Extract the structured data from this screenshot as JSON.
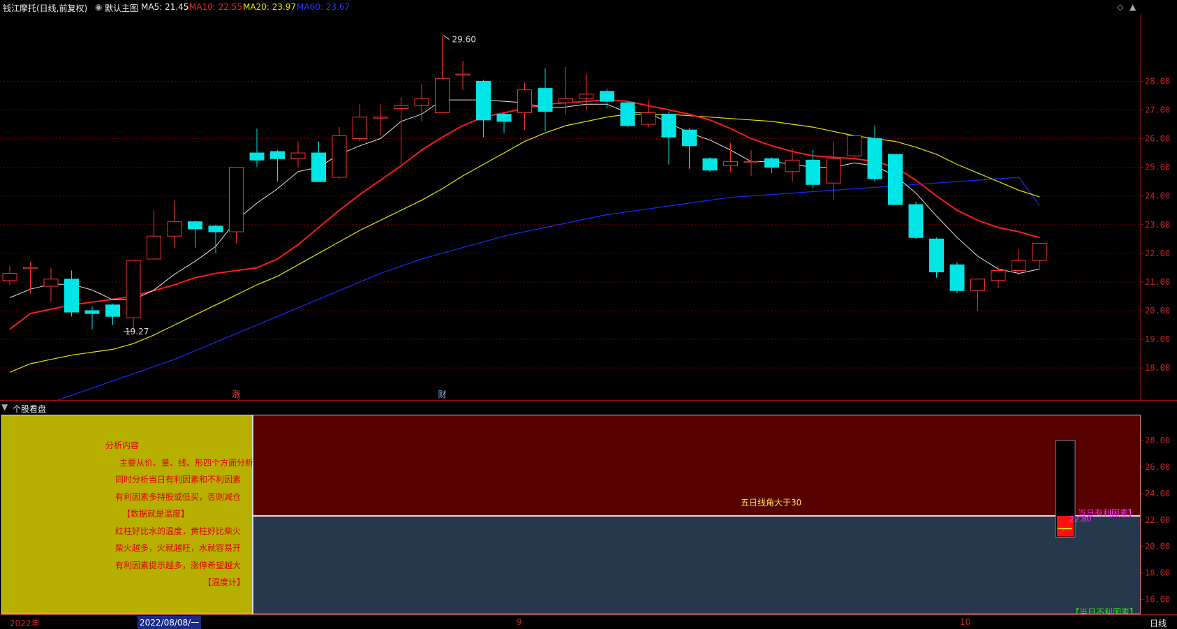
{
  "toolbar": {
    "title": "钱江摩托(日线,前复权)",
    "template": "默认主图",
    "ma5": "MA5: 21.45",
    "ma10": "MA10: 22.55",
    "ma20": "MA20: 23.97",
    "ma60": "MA60: 23.67"
  },
  "colors": {
    "up": "#ff3030",
    "down": "#00e5e5",
    "ma5": "#e8e8e8",
    "ma10": "#ff1a1a",
    "ma20": "#e6e600",
    "ma60": "#1a2aff",
    "grid": "#700000"
  },
  "chart_data": {
    "type": "candlestick",
    "y_ticks": [
      "28.00",
      "27.00",
      "26.00",
      "25.00",
      "24.00",
      "23.00",
      "22.00",
      "21.00",
      "20.00",
      "19.00",
      "18.00"
    ],
    "ylim": [
      17.2,
      30.2
    ],
    "high_label": "29.60",
    "low_label": "19.27",
    "event_markers": [
      {
        "label": "涨",
        "index": 11
      },
      {
        "label": "财",
        "index": 21
      }
    ],
    "candles": [
      {
        "o": 21.05,
        "c": 21.3,
        "h": 21.55,
        "l": 20.9
      },
      {
        "o": 21.5,
        "c": 21.5,
        "h": 21.7,
        "l": 20.6
      },
      {
        "o": 20.85,
        "c": 21.1,
        "h": 21.5,
        "l": 20.3
      },
      {
        "o": 21.1,
        "c": 19.95,
        "h": 21.4,
        "l": 19.8
      },
      {
        "o": 20.0,
        "c": 19.9,
        "h": 20.15,
        "l": 19.35
      },
      {
        "o": 20.2,
        "c": 19.8,
        "h": 20.25,
        "l": 19.5
      },
      {
        "o": 19.75,
        "c": 21.75,
        "h": 21.75,
        "l": 19.27
      },
      {
        "o": 21.8,
        "c": 22.6,
        "h": 23.5,
        "l": 21.8
      },
      {
        "o": 22.6,
        "c": 23.1,
        "h": 23.85,
        "l": 22.2
      },
      {
        "o": 23.1,
        "c": 22.85,
        "h": 23.15,
        "l": 22.2
      },
      {
        "o": 22.95,
        "c": 22.75,
        "h": 23.0,
        "l": 22.0
      },
      {
        "o": 22.75,
        "c": 25.0,
        "h": 25.0,
        "l": 22.35
      },
      {
        "o": 25.5,
        "c": 25.25,
        "h": 26.35,
        "l": 25.0
      },
      {
        "o": 25.55,
        "c": 25.3,
        "h": 25.6,
        "l": 24.5
      },
      {
        "o": 25.3,
        "c": 25.5,
        "h": 25.9,
        "l": 25.0
      },
      {
        "o": 25.5,
        "c": 24.5,
        "h": 25.9,
        "l": 24.5
      },
      {
        "o": 24.65,
        "c": 26.1,
        "h": 26.4,
        "l": 24.6
      },
      {
        "o": 26.0,
        "c": 26.75,
        "h": 27.2,
        "l": 25.9
      },
      {
        "o": 26.75,
        "c": 26.75,
        "h": 27.2,
        "l": 26.1
      },
      {
        "o": 27.05,
        "c": 27.15,
        "h": 27.45,
        "l": 25.1
      },
      {
        "o": 27.15,
        "c": 27.4,
        "h": 27.9,
        "l": 26.6
      },
      {
        "o": 26.9,
        "c": 28.1,
        "h": 29.6,
        "l": 26.9
      },
      {
        "o": 28.25,
        "c": 28.25,
        "h": 28.7,
        "l": 27.7
      },
      {
        "o": 28.0,
        "c": 26.65,
        "h": 28.05,
        "l": 26.05
      },
      {
        "o": 26.85,
        "c": 26.6,
        "h": 26.9,
        "l": 26.2
      },
      {
        "o": 26.9,
        "c": 27.7,
        "h": 27.95,
        "l": 26.3
      },
      {
        "o": 27.75,
        "c": 26.95,
        "h": 28.45,
        "l": 26.25
      },
      {
        "o": 27.25,
        "c": 27.4,
        "h": 28.5,
        "l": 26.85
      },
      {
        "o": 27.4,
        "c": 27.55,
        "h": 28.25,
        "l": 27.0
      },
      {
        "o": 27.65,
        "c": 27.3,
        "h": 27.75,
        "l": 27.05
      },
      {
        "o": 27.25,
        "c": 26.45,
        "h": 27.3,
        "l": 26.4
      },
      {
        "o": 26.5,
        "c": 26.9,
        "h": 27.35,
        "l": 26.4
      },
      {
        "o": 26.85,
        "c": 26.05,
        "h": 26.95,
        "l": 25.1
      },
      {
        "o": 26.3,
        "c": 25.75,
        "h": 26.35,
        "l": 24.95
      },
      {
        "o": 25.3,
        "c": 24.9,
        "h": 25.35,
        "l": 24.85
      },
      {
        "o": 25.05,
        "c": 25.2,
        "h": 25.85,
        "l": 24.85
      },
      {
        "o": 25.2,
        "c": 25.2,
        "h": 25.6,
        "l": 24.7
      },
      {
        "o": 25.3,
        "c": 25.0,
        "h": 25.35,
        "l": 24.8
      },
      {
        "o": 24.85,
        "c": 25.25,
        "h": 25.65,
        "l": 24.5
      },
      {
        "o": 25.25,
        "c": 24.4,
        "h": 25.6,
        "l": 24.25
      },
      {
        "o": 24.45,
        "c": 25.3,
        "h": 25.9,
        "l": 23.85
      },
      {
        "o": 25.4,
        "c": 26.1,
        "h": 26.1,
        "l": 25.3
      },
      {
        "o": 26.0,
        "c": 24.6,
        "h": 26.45,
        "l": 24.5
      },
      {
        "o": 25.45,
        "c": 23.7,
        "h": 25.45,
        "l": 23.7
      },
      {
        "o": 23.7,
        "c": 22.55,
        "h": 23.8,
        "l": 22.5
      },
      {
        "o": 22.5,
        "c": 21.35,
        "h": 22.55,
        "l": 21.15
      },
      {
        "o": 21.6,
        "c": 20.7,
        "h": 21.7,
        "l": 20.6
      },
      {
        "o": 20.7,
        "c": 21.1,
        "h": 21.1,
        "l": 20.0
      },
      {
        "o": 21.05,
        "c": 21.4,
        "h": 21.55,
        "l": 20.8
      },
      {
        "o": 21.4,
        "c": 21.75,
        "h": 22.15,
        "l": 21.25
      },
      {
        "o": 21.75,
        "c": 22.35,
        "h": 22.35,
        "l": 21.45
      }
    ],
    "ma5": [
      20.45,
      20.75,
      20.92,
      20.92,
      20.72,
      20.38,
      20.38,
      20.72,
      21.27,
      21.72,
      22.24,
      23.15,
      23.75,
      24.25,
      24.85,
      25.0,
      25.45,
      25.75,
      26.0,
      26.6,
      26.85,
      27.35,
      27.35,
      27.35,
      27.3,
      27.25,
      27.05,
      27.1,
      27.2,
      27.2,
      26.9,
      26.9,
      26.55,
      26.2,
      25.95,
      25.6,
      25.2,
      25.2,
      25.1,
      25.0,
      25.0,
      25.15,
      25.05,
      24.7,
      24.1,
      23.3,
      22.55,
      21.9,
      21.45,
      21.3,
      21.45
    ],
    "ma10": [
      19.35,
      19.9,
      20.05,
      20.2,
      20.3,
      20.4,
      20.5,
      20.7,
      20.9,
      21.15,
      21.3,
      21.4,
      21.5,
      21.8,
      22.3,
      22.9,
      23.5,
      24.05,
      24.55,
      25.05,
      25.6,
      26.05,
      26.45,
      26.75,
      26.9,
      27.05,
      27.2,
      27.25,
      27.3,
      27.35,
      27.3,
      27.15,
      27.0,
      26.85,
      26.65,
      26.35,
      26.0,
      25.75,
      25.55,
      25.4,
      25.35,
      25.3,
      25.2,
      25.0,
      24.55,
      24.0,
      23.5,
      23.15,
      22.9,
      22.75,
      22.55
    ],
    "ma20": [
      17.85,
      18.15,
      18.3,
      18.45,
      18.55,
      18.65,
      18.85,
      19.15,
      19.5,
      19.85,
      20.2,
      20.55,
      20.9,
      21.2,
      21.6,
      22.0,
      22.4,
      22.8,
      23.15,
      23.5,
      23.85,
      24.25,
      24.7,
      25.1,
      25.5,
      25.9,
      26.2,
      26.45,
      26.6,
      26.75,
      26.85,
      26.85,
      26.85,
      26.8,
      26.75,
      26.7,
      26.65,
      26.6,
      26.5,
      26.4,
      26.25,
      26.1,
      26.0,
      25.9,
      25.7,
      25.45,
      25.1,
      24.8,
      24.5,
      24.2,
      23.97
    ],
    "ma60": [
      16.2,
      16.5,
      16.8,
      17.05,
      17.3,
      17.55,
      17.8,
      18.05,
      18.3,
      18.6,
      18.9,
      19.2,
      19.5,
      19.8,
      20.1,
      20.4,
      20.7,
      21.0,
      21.3,
      21.55,
      21.8,
      22.0,
      22.2,
      22.4,
      22.6,
      22.75,
      22.9,
      23.05,
      23.2,
      23.35,
      23.45,
      23.55,
      23.65,
      23.75,
      23.85,
      23.95,
      24.0,
      24.05,
      24.1,
      24.15,
      24.2,
      24.25,
      24.3,
      24.35,
      24.4,
      24.45,
      24.5,
      24.55,
      24.6,
      24.65,
      23.67
    ]
  },
  "panel2": {
    "title": "个股看盘",
    "analysis_lines": [
      "分析内容",
      "主要从价、量、线、形四个方面分析",
      "同时分析当日有利因素和不利因素",
      "有利因素多持股或低买，否则减仓",
      "【数据就是温度】",
      "红柱好比水的温度，黄柱好比柴火",
      "柴火越多，火就越旺，水就容易开",
      "有利因素提示越多，涨停希望越大",
      "【温度计】"
    ],
    "signal_text": "五日线角大于30",
    "favorable_label": "当日有利因素】",
    "unfavorable_label": "【当日不利因素】",
    "thermometer_value": "22.80",
    "y_ticks": [
      "28.00",
      "26.00",
      "24.00",
      "22.00",
      "20.00",
      "18.00",
      "16.00"
    ],
    "thermo_level": 22.3,
    "thermo_top": 28.0,
    "thermo_bottom": 20.7
  },
  "bottom_bar": {
    "year": "2022年",
    "cursor_date": "2022/08/08/一",
    "month1": "9",
    "month2": "10",
    "period": "日线"
  }
}
